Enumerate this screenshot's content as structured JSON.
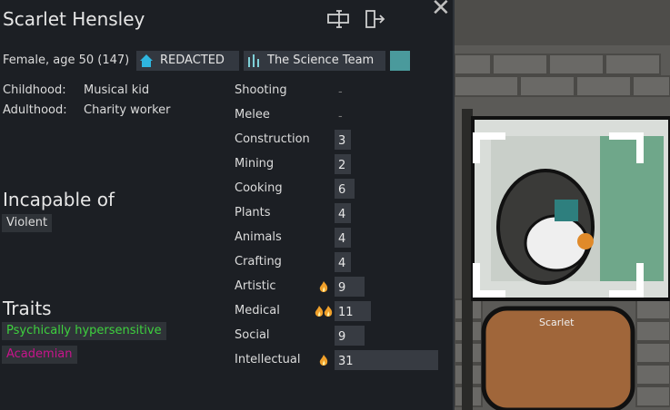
{
  "pawn": {
    "name": "Scarlet Hensley",
    "age_text": "Female, age 50 (147)",
    "faction_tag": "REDACTED",
    "team_tag": "The Science Team",
    "color_swatch": "#4a9a9c"
  },
  "backstory": {
    "childhood_label": "Childhood:",
    "childhood_value": "Musical kid",
    "adulthood_label": "Adulthood:",
    "adulthood_value": "Charity worker"
  },
  "incapable": {
    "title": "Incapable of",
    "items": [
      "Violent"
    ]
  },
  "traits": {
    "title": "Traits",
    "items": [
      {
        "label": "Psychically hypersensitive",
        "color": "#3ed13e"
      },
      {
        "label": "Academian",
        "color": "#c8148c"
      }
    ]
  },
  "skills": [
    {
      "name": "Shooting",
      "level": null,
      "passion": 0,
      "display": "-"
    },
    {
      "name": "Melee",
      "level": null,
      "passion": 0,
      "display": "-"
    },
    {
      "name": "Construction",
      "level": 3,
      "passion": 0,
      "display": "3"
    },
    {
      "name": "Mining",
      "level": 2,
      "passion": 0,
      "display": "2"
    },
    {
      "name": "Cooking",
      "level": 6,
      "passion": 0,
      "display": "6"
    },
    {
      "name": "Plants",
      "level": 4,
      "passion": 0,
      "display": "4"
    },
    {
      "name": "Animals",
      "level": 4,
      "passion": 0,
      "display": "4"
    },
    {
      "name": "Crafting",
      "level": 4,
      "passion": 0,
      "display": "4"
    },
    {
      "name": "Artistic",
      "level": 9,
      "passion": 1,
      "display": "9"
    },
    {
      "name": "Medical",
      "level": 11,
      "passion": 2,
      "display": "11"
    },
    {
      "name": "Social",
      "level": 9,
      "passion": 0,
      "display": "9"
    },
    {
      "name": "Intellectual",
      "level": 31,
      "passion": 1,
      "display": "31"
    }
  ],
  "scene": {
    "pawn_label": "Scarlet"
  },
  "icons": {
    "rename": "rename-icon",
    "banish": "exit-door-icon",
    "close": "close-icon",
    "faction": "house-icon",
    "team": "ideology-icon",
    "passion": "flame-icon"
  }
}
